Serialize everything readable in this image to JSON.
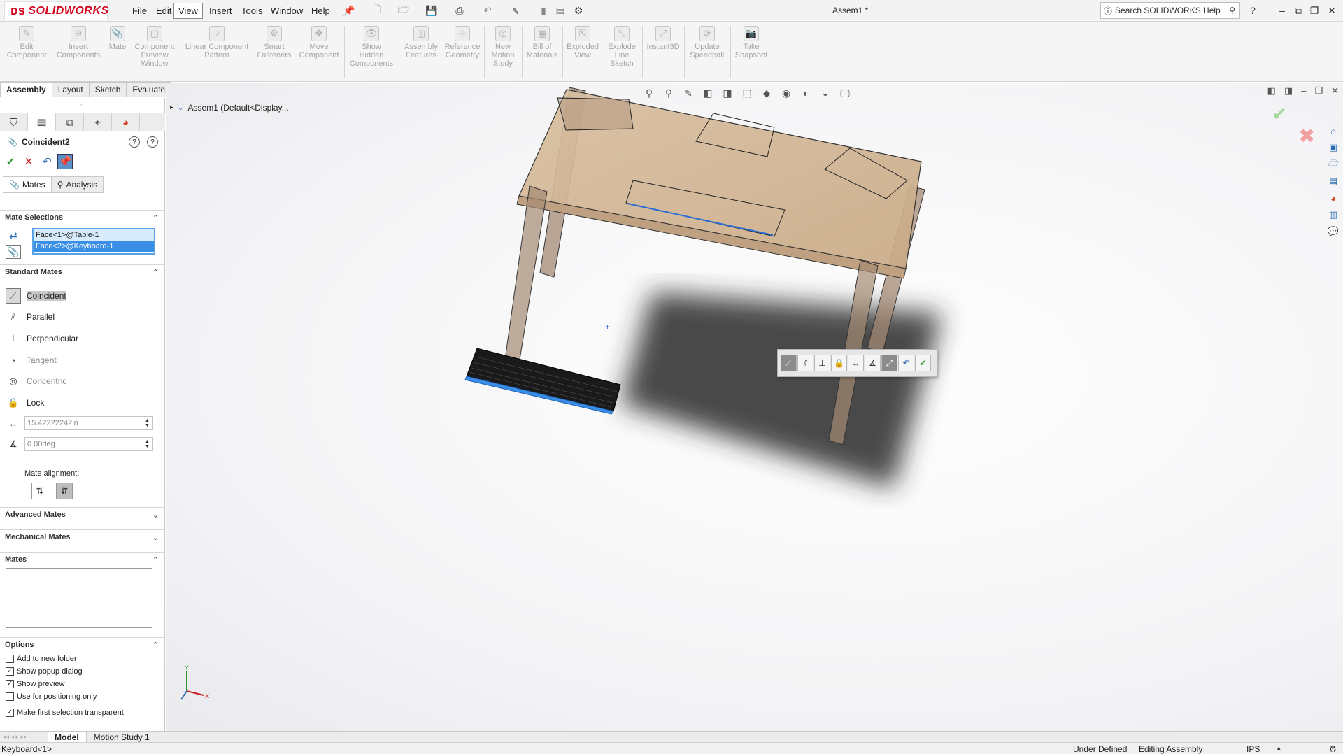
{
  "app": {
    "logo": "SOLIDWORKS",
    "title": "Assem1 *",
    "search_placeholder": "Search SOLIDWORKS Help"
  },
  "menu": [
    "File",
    "Edit",
    "View",
    "Insert",
    "Tools",
    "Window",
    "Help"
  ],
  "commands": [
    {
      "label": "Edit\nComponent",
      "icon": "edit-component-icon"
    },
    {
      "label": "Insert\nComponents",
      "icon": "insert-components-icon"
    },
    {
      "label": "Mate",
      "icon": "mate-icon"
    },
    {
      "label": "Component\nPreview\nWindow",
      "icon": "preview-window-icon"
    },
    {
      "label": "Linear Component\nPattern",
      "icon": "linear-pattern-icon"
    },
    {
      "label": "Smart\nFasteners",
      "icon": "smart-fasteners-icon"
    },
    {
      "label": "Move\nComponent",
      "icon": "move-component-icon"
    },
    {
      "label": "Show\nHidden\nComponents",
      "icon": "show-hidden-icon"
    },
    {
      "label": "Assembly\nFeatures",
      "icon": "assembly-features-icon"
    },
    {
      "label": "Reference\nGeometry",
      "icon": "reference-geometry-icon"
    },
    {
      "label": "New\nMotion\nStudy",
      "icon": "motion-study-icon"
    },
    {
      "label": "Bill of\nMaterials",
      "icon": "bom-icon"
    },
    {
      "label": "Exploded\nView",
      "icon": "exploded-view-icon"
    },
    {
      "label": "Explode\nLine\nSketch",
      "icon": "explode-line-icon"
    },
    {
      "label": "Instant3D",
      "icon": "instant3d-icon"
    },
    {
      "label": "Update\nSpeedpak",
      "icon": "speedpak-icon"
    },
    {
      "label": "Take\nSnapshot",
      "icon": "snapshot-icon"
    }
  ],
  "cmd_tabs": [
    "Assembly",
    "Layout",
    "Sketch",
    "Evaluate"
  ],
  "property_manager": {
    "title": "Coincident2",
    "sub_tabs": [
      "Mates",
      "Analysis"
    ],
    "mate_selections_header": "Mate Selections",
    "selections": [
      "Face<1>@Table-1",
      "Face<2>@Keyboard-1"
    ],
    "standard_mates_header": "Standard Mates",
    "standard_mates": [
      "Coincident",
      "Parallel",
      "Perpendicular",
      "Tangent",
      "Concentric",
      "Lock"
    ],
    "distance_value": "15.42222242in",
    "angle_value": "0.00deg",
    "mate_alignment_label": "Mate alignment:",
    "advanced_mates_header": "Advanced Mates",
    "mechanical_mates_header": "Mechanical Mates",
    "mates_header": "Mates",
    "options_header": "Options",
    "options": [
      {
        "label": "Add to new folder",
        "checked": false
      },
      {
        "label": "Show popup dialog",
        "checked": true
      },
      {
        "label": "Show preview",
        "checked": true
      },
      {
        "label": "Use for positioning only",
        "checked": false
      },
      {
        "label": "Make first selection transparent",
        "checked": true
      }
    ]
  },
  "tree_root": "Assem1  (Default<Display...",
  "bottom_tabs": [
    "Model",
    "Motion Study 1"
  ],
  "status": {
    "left": "Keyboard<1>",
    "under_defined": "Under Defined",
    "editing": "Editing Assembly",
    "units": "IPS"
  },
  "colors": {
    "table_top": "#d9bfa0",
    "table_leg": "#a48a74",
    "keyboard": "#1a1a1a",
    "selection_blue": "#3a8ee6",
    "brand_red": "#d4001a"
  },
  "axes": {
    "x": "X",
    "y": "Y"
  }
}
